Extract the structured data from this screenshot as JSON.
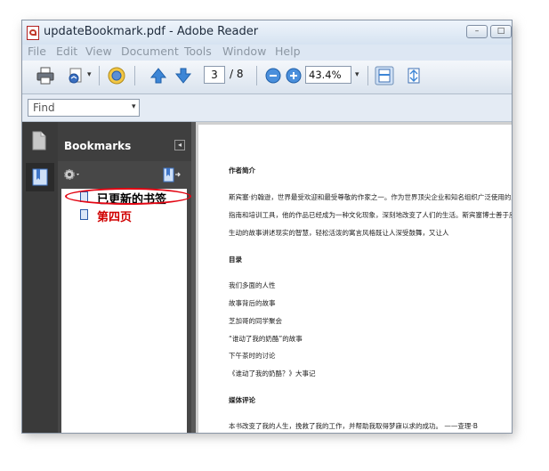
{
  "window": {
    "title": "updateBookmark.pdf - Adobe Reader",
    "minimize_glyph": "–",
    "maximize_glyph": "□"
  },
  "menu": [
    "File",
    "Edit",
    "View",
    "Document",
    "Tools",
    "Window",
    "Help"
  ],
  "toolbar": {
    "icons": [
      "print-icon",
      "email-icon",
      "collaborate-icon",
      "previous-page-icon",
      "next-page-icon",
      "zoom-out-icon",
      "zoom-in-icon",
      "fit-page-icon",
      "fit-width-icon"
    ],
    "current_page": "3",
    "page_total": "/ 8",
    "zoom": "43.4%",
    "dropdown_glyph": "▾"
  },
  "find": {
    "placeholder": "Find",
    "dropdown_glyph": "▾"
  },
  "bookmarks": {
    "title": "Bookmarks",
    "collapse_glyph": "◂",
    "items": [
      {
        "label": "已更新的书签",
        "color": "#000000"
      },
      {
        "label": "第四页",
        "color": "#d00000"
      }
    ]
  },
  "document": {
    "lines": [
      {
        "text": "作者简介",
        "heading": true
      },
      {
        "text": "斯宾塞·约翰逊，世界最受欢迎和最受尊敬的作家之一。作为世界顶尖企业和知名组织广泛使用的工作",
        "heading": false
      },
      {
        "text": "指南和培训工具，他的作品已经成为一种文化现象，深刻地改变了人们的生活。斯宾塞博士善于应用",
        "heading": false
      },
      {
        "text": "生动的故事讲述现实的智慧，轻松活泼的寓言风格既让人深受鼓舞，又让人",
        "heading": false
      },
      {
        "text": "目录",
        "heading": true
      },
      {
        "text": "我们多面的人性",
        "heading": false
      },
      {
        "text": "故事背后的故事",
        "heading": false
      },
      {
        "text": "芝加哥的同学聚会",
        "heading": false
      },
      {
        "text": "“谁动了我的奶酪”的故事",
        "heading": false
      },
      {
        "text": "下午茶时的讨论",
        "heading": false
      },
      {
        "text": "《谁动了我的奶酪？》大事记",
        "heading": false
      },
      {
        "text": "媒体评论",
        "heading": true
      },
      {
        "text": "本书改变了我的人生，挽救了我的工作，并帮助我取得梦寐以求的成功。           ——查理·B",
        "heading": false
      }
    ]
  },
  "colors": {
    "accent_blue": "#2f74c8",
    "highlight_red": "#e30613"
  }
}
